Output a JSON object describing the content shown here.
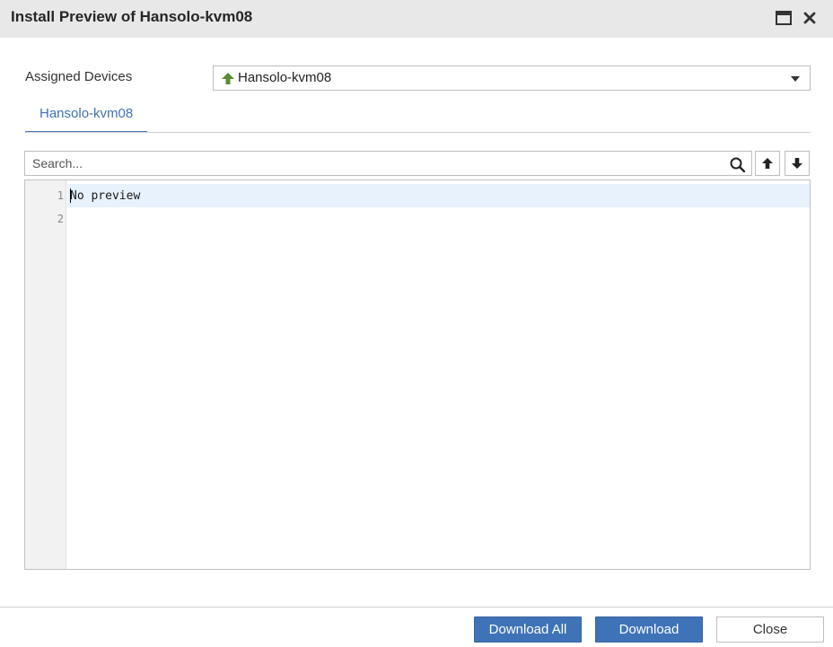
{
  "dialog": {
    "title": "Install Preview of Hansolo-kvm08"
  },
  "assigned_devices": {
    "label": "Assigned Devices",
    "selected": "Hansolo-kvm08",
    "selected_icon": "up-arrow-icon",
    "status_color": "#5a8a32"
  },
  "tabs": [
    {
      "label": "Hansolo-kvm08",
      "active": true
    }
  ],
  "search": {
    "placeholder": "Search...",
    "value": ""
  },
  "editor": {
    "lines": [
      {
        "number": "1",
        "text": "No preview"
      },
      {
        "number": "2",
        "text": ""
      }
    ]
  },
  "footer": {
    "download_all_label": "Download All",
    "download_label": "Download",
    "close_label": "Close"
  },
  "colors": {
    "accent": "#3f73b8",
    "titlebar": "#e8e8e8",
    "active_line": "#e8f2fd"
  }
}
